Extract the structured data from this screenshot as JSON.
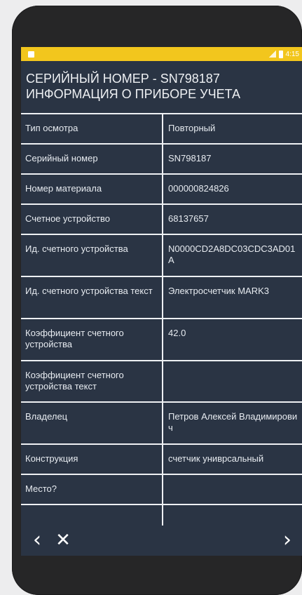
{
  "status_bar": {
    "time": "4:15",
    "icons": [
      "notification-icon",
      "signal-icon",
      "battery-icon"
    ]
  },
  "header": {
    "title_line1": "СЕРИЙНЫЙ НОМЕР - SN798187",
    "title_line2": "ИНФОРМАЦИЯ О ПРИБОРЕ УЧЕТА"
  },
  "rows": [
    {
      "label": "Тип осмотра",
      "value": "Повторный"
    },
    {
      "label": "Серийный номер",
      "value": "SN798187"
    },
    {
      "label": "Номер материала",
      "value": "000000824826"
    },
    {
      "label": "Счетное устройство",
      "value": "68137657"
    },
    {
      "label": "Ид. счетного устройства",
      "value": "N0000CD2A8DC03CDC3AD01A"
    },
    {
      "label": "Ид. счетного устройства текст",
      "value": "Электросчетчик MARK3"
    },
    {
      "label": "Коэффициент счетного устройства",
      "value": "42.0"
    },
    {
      "label": "Коэффициент счетного устройства текст",
      "value": ""
    },
    {
      "label": "Владелец",
      "value": "Петров Алексей Владимирович"
    },
    {
      "label": "Конструкция",
      "value": "счетчик униврсальный"
    },
    {
      "label": "Место?",
      "value": ""
    }
  ],
  "bottom_bar": {
    "back_icon": "chevron-left-icon",
    "close_icon": "close-icon",
    "forward_icon": "chevron-right-icon",
    "back_glyph": "‹",
    "close_glyph": "✕",
    "forward_glyph": "›"
  },
  "colors": {
    "status_bar": "#f2c61d",
    "screen_background": "#2a3444",
    "grid_lines": "#eef0f3"
  }
}
